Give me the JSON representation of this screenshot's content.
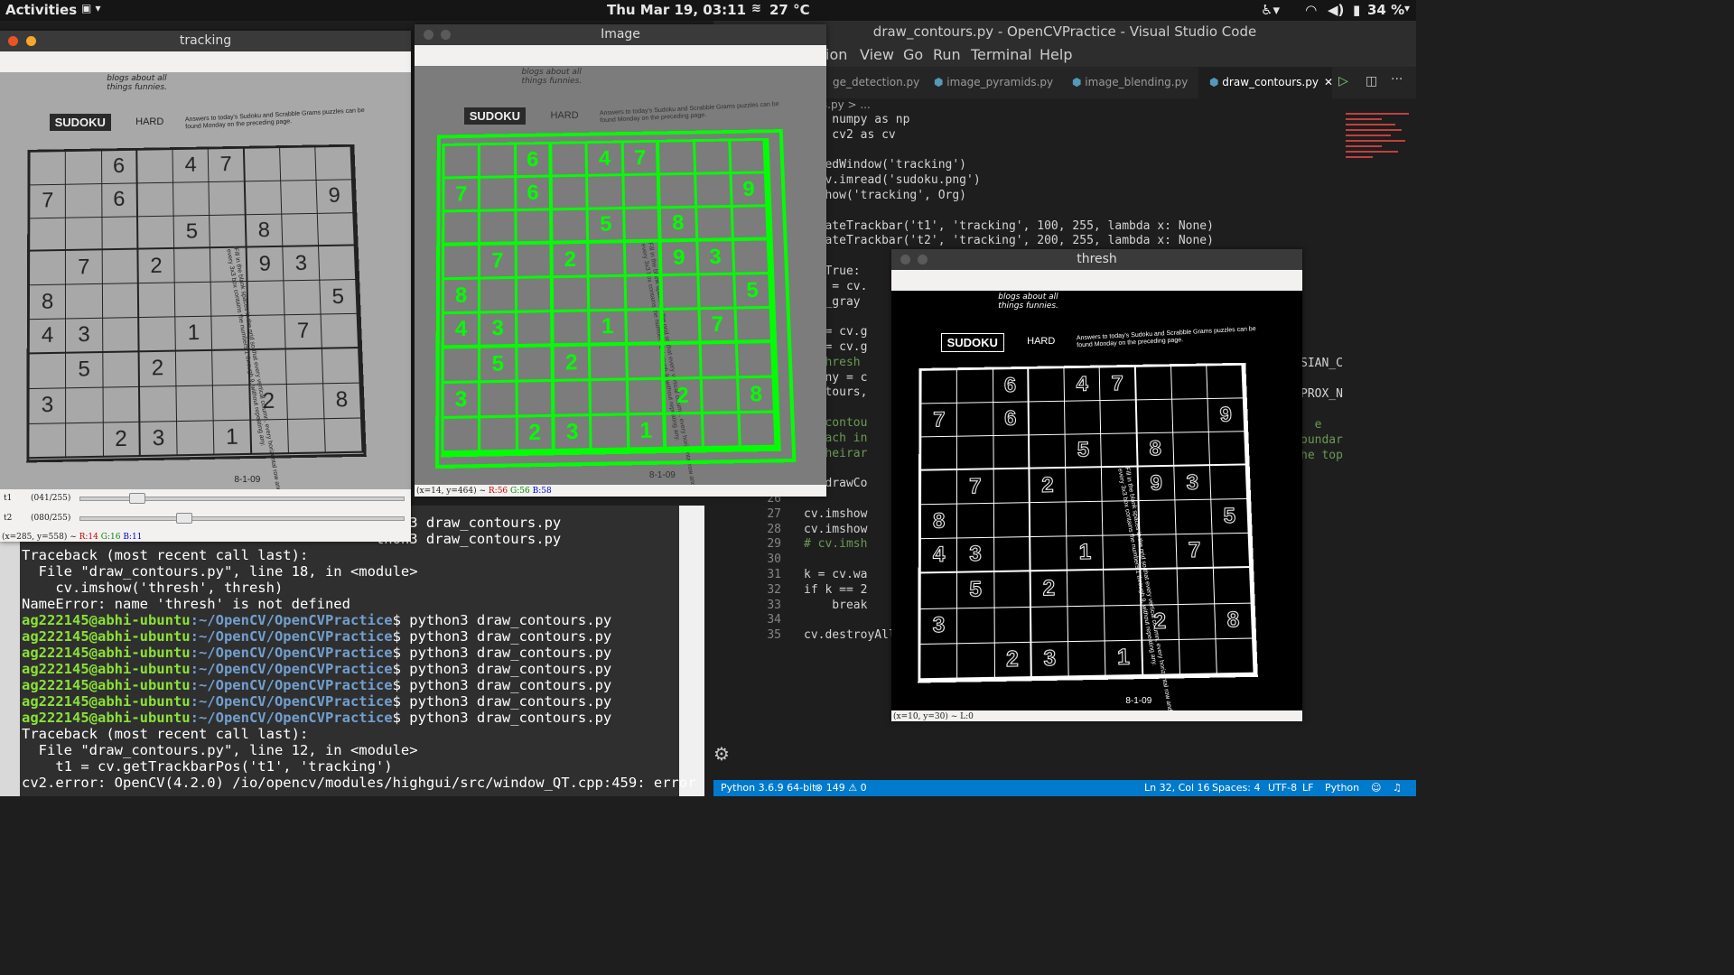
{
  "topbar": {
    "activities": "Activities",
    "flag": "🇺🇸",
    "clock": "Thu Mar 19, 03:11",
    "weather": "27 °C",
    "battery": "34 %"
  },
  "vscode": {
    "title": "draw_contours.py - OpenCVPractice - Visual Studio Code",
    "menu": [
      "ion",
      "View",
      "Go",
      "Run",
      "Terminal",
      "Help"
    ],
    "tabs": [
      "ge_detection.py",
      "image_pyramids.py",
      "image_blending.py",
      "draw_contours.py"
    ],
    "breadcrumb": "ours.py > ...",
    "code": [
      "ort numpy as np",
      "ort cv2 as cv",
      "",
      "namedWindow('tracking')",
      "= cv.imread('sudoku.png')",
      "imshow('tracking', Org)",
      "",
      "createTrackbar('t1', 'tracking', 100, 255, lambda x: None)",
      "createTrackbar('t2', 'tracking', 200, 255, lambda x: None)",
      "",
      "le True:",
      "img = cv.",
      "img_gray",
      "",
      "t1 = cv.g",
      "t2 = cv.g",
      "# thresh",
      "canny = c",
      "contours,",
      "",
      "# \"contou",
      "# each in",
      "# \"heirar",
      "",
      "cv.drawCo",
      "",
      "cv.imshow",
      "cv.imshow",
      "# cv.imsh",
      "",
      "k = cv.wa",
      "if k == 2",
      "    break",
      "",
      "cv.destroyAll"
    ],
    "line_numbers": [
      "26",
      "27",
      "28",
      "29",
      "30",
      "31",
      "32",
      "33",
      "34",
      "35"
    ],
    "right_fragments": [
      "SIAN_C",
      "PROX_N",
      "e",
      "oundar",
      "he top"
    ],
    "status": {
      "python": "Python 3.6.9 64-bit",
      "problems": "⊗ 149 ⚠ 0",
      "position": "Ln 32, Col 16",
      "spaces": "Spaces: 4",
      "encoding": "UTF-8",
      "eol": "LF",
      "lang": "Python"
    }
  },
  "terminal": {
    "lines": [
      {
        "t": "plain",
        "text": "                                          thon3 draw_contours.py"
      },
      {
        "t": "plain",
        "text": "                                          thon3 draw_contours.py"
      },
      {
        "t": "plain",
        "text": "Traceback (most recent call last):"
      },
      {
        "t": "plain",
        "text": "  File \"draw_contours.py\", line 18, in <module>"
      },
      {
        "t": "plain",
        "text": "    cv.imshow('thresh', thresh)"
      },
      {
        "t": "plain",
        "text": "NameError: name 'thresh' is not defined"
      },
      {
        "t": "prompt",
        "user": "ag222145@abhi-ubuntu",
        "path": ":~/OpenCV/OpenCVPractice",
        "cmd": "$ python3 draw_contours.py"
      },
      {
        "t": "prompt",
        "user": "ag222145@abhi-ubuntu",
        "path": ":~/OpenCV/OpenCVPractice",
        "cmd": "$ python3 draw_contours.py"
      },
      {
        "t": "prompt",
        "user": "ag222145@abhi-ubuntu",
        "path": ":~/OpenCV/OpenCVPractice",
        "cmd": "$ python3 draw_contours.py"
      },
      {
        "t": "prompt",
        "user": "ag222145@abhi-ubuntu",
        "path": ":~/OpenCV/OpenCVPractice",
        "cmd": "$ python3 draw_contours.py"
      },
      {
        "t": "prompt",
        "user": "ag222145@abhi-ubuntu",
        "path": ":~/OpenCV/OpenCVPractice",
        "cmd": "$ python3 draw_contours.py"
      },
      {
        "t": "prompt",
        "user": "ag222145@abhi-ubuntu",
        "path": ":~/OpenCV/OpenCVPractice",
        "cmd": "$ python3 draw_contours.py"
      },
      {
        "t": "prompt",
        "user": "ag222145@abhi-ubuntu",
        "path": ":~/OpenCV/OpenCVPractice",
        "cmd": "$ python3 draw_contours.py"
      },
      {
        "t": "plain",
        "text": "Traceback (most recent call last):"
      },
      {
        "t": "plain",
        "text": "  File \"draw_contours.py\", line 12, in <module>"
      },
      {
        "t": "plain",
        "text": "    t1 = cv.getTrackbarPos('t1', 'tracking')"
      },
      {
        "t": "plain",
        "text": "cv2.error: OpenCV(4.2.0) /io/opencv/modules/highgui/src/window_QT.cpp:459: error"
      }
    ]
  },
  "tracking": {
    "title": "tracking",
    "t1_label": "t1",
    "t1_value": "(041/255)",
    "t1_level": 0.161,
    "t2_label": "t2",
    "t2_value": "(080/255)",
    "t2_level": 0.314,
    "status_pre": "(x=285, y=558) ~ ",
    "r": "R:14",
    "g": "G:16",
    "b": "B:11"
  },
  "image": {
    "title": "Image",
    "status_pre": "(x=14, y=464) ~ ",
    "r": "R:56",
    "g": "G:56",
    "b": "B:58"
  },
  "thresh": {
    "title": "thresh",
    "status": "(x=10, y=30) ~ L:0"
  },
  "sudoku": {
    "blurb": "blogs about all things funnies.",
    "heading": "SUDOKU",
    "level": "HARD",
    "instructions": "Answers to today's Sudoku and Scrabble Grams puzzles can be found Monday on the preceding page.",
    "side_text": "Fill in the blank spaces in the grid so that every vertical column, every horizontal row and every 3x3 box contains the numbers 1 through 9, without repeating any.",
    "date": "8-1-09",
    "cells": [
      "",
      "",
      "6",
      "",
      "4",
      "7",
      "",
      "",
      "",
      "7",
      "",
      "6",
      "",
      "",
      "",
      "",
      "",
      "9",
      "",
      "",
      "",
      "",
      "5",
      "",
      "8",
      "",
      "",
      "",
      "7",
      "",
      "2",
      "",
      "",
      "9",
      "3",
      "",
      "8",
      "",
      "",
      "",
      "",
      "",
      "",
      "",
      "5",
      "4",
      "3",
      "",
      "",
      "1",
      "",
      "",
      "7",
      "",
      "",
      "5",
      "",
      "2",
      "",
      "",
      "",
      "",
      "",
      "3",
      "",
      "",
      "",
      "",
      "",
      "2",
      "",
      "8",
      "",
      "",
      "2",
      "3",
      "",
      "1",
      "",
      "",
      ""
    ]
  }
}
